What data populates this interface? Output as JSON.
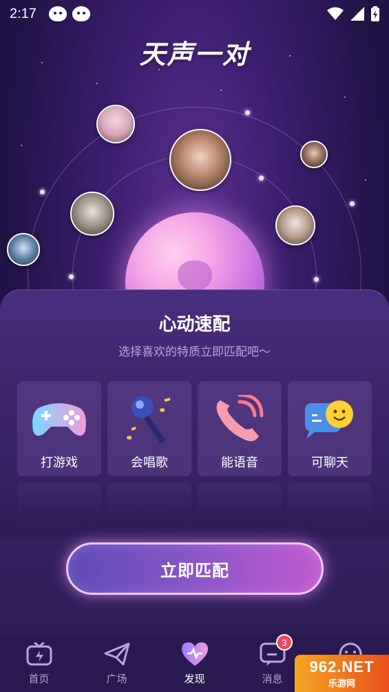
{
  "status_bar": {
    "time": "2:17"
  },
  "header": {
    "logo_text": "天声一对"
  },
  "match_panel": {
    "title": "心动速配",
    "subtitle": "选择喜欢的特质立即匹配吧～",
    "categories": [
      {
        "label": "打游戏",
        "icon": "gamepad-icon"
      },
      {
        "label": "会唱歌",
        "icon": "microphone-icon"
      },
      {
        "label": "能语音",
        "icon": "phone-icon"
      },
      {
        "label": "可聊天",
        "icon": "chat-bubble-icon"
      }
    ],
    "match_button_label": "立即匹配"
  },
  "bottom_nav": {
    "items": [
      {
        "label": "首页",
        "icon": "home-tv-icon",
        "active": false
      },
      {
        "label": "广场",
        "icon": "paper-plane-icon",
        "active": false
      },
      {
        "label": "发现",
        "icon": "heart-icon",
        "active": true
      },
      {
        "label": "消息",
        "icon": "message-icon",
        "active": false,
        "badge": "3"
      },
      {
        "label": "",
        "icon": "profile-face-icon",
        "active": false
      }
    ]
  },
  "watermark": {
    "top": "962.NET",
    "bottom": "乐游网"
  },
  "colors": {
    "background": "#231449",
    "panel": "#3c2467",
    "accent_pink": "#f3c7ff",
    "badge_red": "#ef4560"
  }
}
